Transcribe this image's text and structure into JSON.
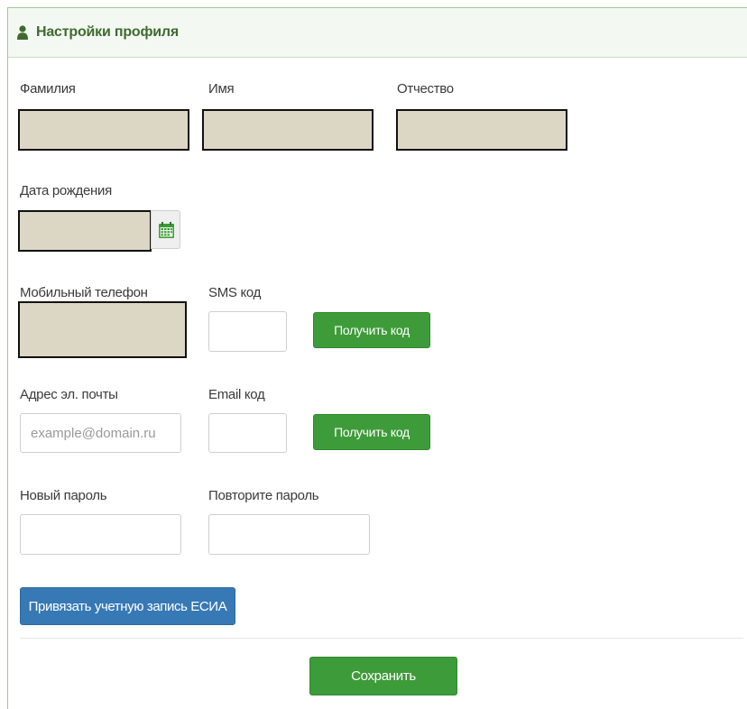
{
  "header": {
    "title": "Настройки профиля",
    "icon": "user-icon"
  },
  "fields": {
    "last_name_label": "Фамилия",
    "first_name_label": "Имя",
    "patronymic_label": "Отчество",
    "birth_date_label": "Дата рождения",
    "mobile_label": "Мобильный телефон",
    "sms_code_label": "SMS код",
    "email_label": "Адрес эл. почты",
    "email_placeholder": "example@domain.ru",
    "email_code_label": "Email код",
    "new_password_label": "Новый пароль",
    "repeat_password_label": "Повторите пароль"
  },
  "buttons": {
    "get_sms_code": "Получить код",
    "get_email_code": "Получить код",
    "link_esia": "Привязать учетную запись ЕСИА",
    "save": "Сохранить"
  },
  "colors": {
    "accent_green": "#3e9b3a",
    "accent_blue": "#3779b4",
    "redaction_fill": "#dcd7c5"
  }
}
